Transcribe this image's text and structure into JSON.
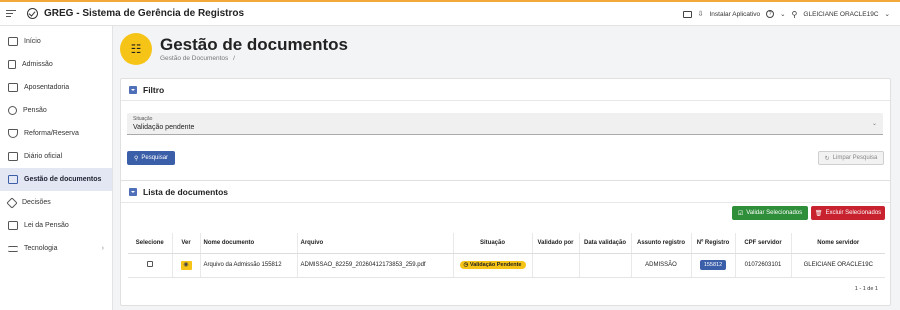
{
  "header": {
    "menu_icon": "hamburger-icon",
    "logo_icon": "check-circle-icon",
    "title": "GREG - Sistema de Gerência de Registros",
    "install_label": "Instalar Aplicativo",
    "help_label": "?",
    "user_name": "GLEICIANE ORACLE19C"
  },
  "sidebar": {
    "items": [
      {
        "label": "Início",
        "icon": "monitor-icon"
      },
      {
        "label": "Admissão",
        "icon": "clipboard-icon"
      },
      {
        "label": "Aposentadoria",
        "icon": "card-icon"
      },
      {
        "label": "Pensão",
        "icon": "dollar-icon"
      },
      {
        "label": "Reforma/Reserva",
        "icon": "shield-icon"
      },
      {
        "label": "Diário oficial",
        "icon": "newspaper-icon"
      },
      {
        "label": "Gestão de documentos",
        "icon": "documents-icon",
        "active": true
      },
      {
        "label": "Decisões",
        "icon": "gavel-icon"
      },
      {
        "label": "Lei da Pensão",
        "icon": "book-icon"
      },
      {
        "label": "Tecnologia",
        "icon": "sliders-icon",
        "has_children": true
      }
    ]
  },
  "page": {
    "title": "Gestão de documentos",
    "breadcrumb": "Gestão de Documentos",
    "breadcrumb_sep": "/",
    "icon": "documents-icon"
  },
  "filter": {
    "title": "Filtro",
    "situacao_label": "Situação",
    "situacao_value": "Validação pendente",
    "search_button": "Pesquisar",
    "clear_button": "Limpar Pesquisa"
  },
  "list": {
    "title": "Lista de documentos",
    "validate_button": "Validar Selecionados",
    "delete_button": "Excluir Selecionados",
    "columns": [
      "Selecione",
      "Ver",
      "Nome documento",
      "Arquivo",
      "Situação",
      "Validado por",
      "Data validação",
      "Assunto registro",
      "Nº Registro",
      "CPF servidor",
      "Nome servidor"
    ],
    "rows": [
      {
        "nome_documento": "Arquivo da Admissão 155812",
        "arquivo": "ADMISSAO_82259_20260412173853_259.pdf",
        "situacao": "Validação Pendente",
        "validado_por": "",
        "data_validacao": "",
        "assunto_registro": "ADMISSÃO",
        "n_registro": "155812",
        "cpf_servidor": "01072603101",
        "nome_servidor": "GLEICIANE ORACLE19C"
      }
    ],
    "pagination": "1 - 1 de 1"
  },
  "colors": {
    "accent": "#f6c416",
    "primary": "#3b5ea8",
    "success": "#2f8e3a",
    "danger": "#c7222e",
    "top_border": "#f2a93b"
  }
}
